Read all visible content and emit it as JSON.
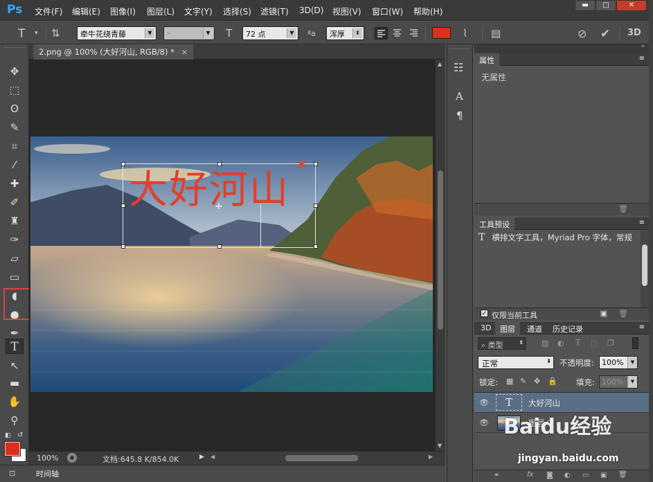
{
  "app": {
    "logo": "Ps"
  },
  "menu": [
    "文件(F)",
    "编辑(E)",
    "图像(I)",
    "图层(L)",
    "文字(Y)",
    "选择(S)",
    "滤镜(T)",
    "3D(D)",
    "视图(V)",
    "窗口(W)",
    "帮助(H)"
  ],
  "window_controls": {
    "minimize": "▬",
    "maximize": "□",
    "close": "✕"
  },
  "options": {
    "font_family": "牵牛花绕青藤",
    "font_style": "-",
    "font_size": "72 点",
    "antialias_label": "ªa",
    "antialias": "浑厚",
    "text_color": "#e02d1e",
    "threed": "3D"
  },
  "document": {
    "tab_title": "2.png @ 100% (大好河山, RGB/8) *",
    "close": "×",
    "text_layer_text": "大好河山",
    "text_color": "#e0402a"
  },
  "status": {
    "zoom": "100%",
    "doc_info": "文档:645.8 K/854.0K"
  },
  "timeline": {
    "label": "时间轴"
  },
  "panels": {
    "properties": {
      "title": "属性",
      "content": "无属性"
    },
    "tool_presets": {
      "title": "工具预设",
      "item": "横排文字工具，Myriad Pro 字体，常规",
      "checkbox_label": "仅限当前工具"
    },
    "layers": {
      "tabs": [
        "3D",
        "图层",
        "通道",
        "历史记录"
      ],
      "filter_kind": "类型",
      "blend_mode": "正常",
      "opacity_label": "不透明度:",
      "opacity": "100%",
      "lock_label": "锁定:",
      "fill_label": "填充:",
      "fill": "100%",
      "items": [
        {
          "name": "大好河山",
          "type": "text",
          "selected": true
        },
        {
          "name": "图层 0",
          "type": "image",
          "selected": false
        }
      ]
    }
  },
  "watermark": {
    "brand": "Baidu经验",
    "url": "jingyan.baidu.com"
  },
  "colors": {
    "accent": "#36a6ff",
    "highlight_box": "#e04040",
    "foreground": "#e02d1e",
    "background": "#ffffff",
    "selected_layer": "#5a6f86"
  }
}
